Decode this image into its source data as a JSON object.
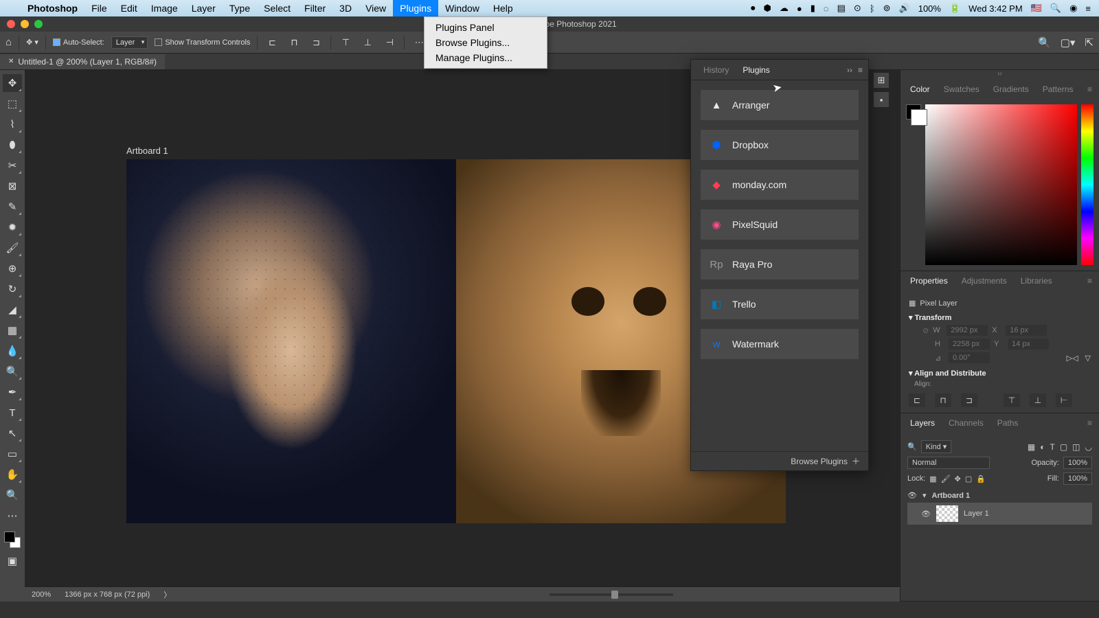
{
  "menubar": {
    "app": "Photoshop",
    "items": [
      "File",
      "Edit",
      "Image",
      "Layer",
      "Type",
      "Select",
      "Filter",
      "3D",
      "View",
      "Plugins",
      "Window",
      "Help"
    ],
    "active_index": 9,
    "tray": {
      "battery": "100%",
      "time": "Wed 3:42 PM"
    }
  },
  "dropdown": {
    "items": [
      "Plugins Panel",
      "Browse Plugins...",
      "Manage Plugins..."
    ]
  },
  "titlebar": {
    "title": "Adobe Photoshop 2021"
  },
  "optionsbar": {
    "auto_select_label": "Auto-Select:",
    "auto_select_target": "Layer",
    "show_transform_label": "Show Transform Controls"
  },
  "doc_tab": {
    "label": "Untitled-1 @ 200% (Layer 1, RGB/8#)"
  },
  "artboard": {
    "label": "Artboard 1"
  },
  "statusbar": {
    "zoom": "200%",
    "dims": "1366 px x 768 px (72 ppi)"
  },
  "plugins_panel": {
    "tabs": [
      "History",
      "Plugins"
    ],
    "active_tab": 1,
    "items": [
      {
        "icon": "▲",
        "color": "#e8e8e8",
        "name": "Arranger"
      },
      {
        "icon": "⬢",
        "color": "#0061ff",
        "name": "Dropbox"
      },
      {
        "icon": "◆",
        "color": "#ff3d57",
        "name": "monday.com"
      },
      {
        "icon": "◉",
        "color": "#ff4a8d",
        "name": "PixelSquid"
      },
      {
        "icon": "Rp",
        "color": "#999",
        "name": "Raya Pro"
      },
      {
        "icon": "◧",
        "color": "#0079bf",
        "name": "Trello"
      },
      {
        "icon": "w",
        "color": "#1473e6",
        "name": "Watermark"
      }
    ],
    "footer": "Browse Plugins"
  },
  "right": {
    "color_tabs": [
      "Color",
      "Swatches",
      "Gradients",
      "Patterns"
    ],
    "prop_tabs": [
      "Properties",
      "Adjustments",
      "Libraries"
    ],
    "layer_tabs": [
      "Layers",
      "Channels",
      "Paths"
    ],
    "properties": {
      "kind": "Pixel Layer",
      "transform_label": "Transform",
      "w": "2992 px",
      "h": "2258 px",
      "x": "16 px",
      "y": "14 px",
      "angle": "0.00°",
      "align_label": "Align and Distribute",
      "align_sub": "Align:"
    },
    "layers": {
      "kind": "Kind",
      "blend": "Normal",
      "opacity_label": "Opacity:",
      "opacity": "100%",
      "lock_label": "Lock:",
      "fill_label": "Fill:",
      "fill": "100%",
      "items": [
        {
          "name": "Artboard 1",
          "artboard": true
        },
        {
          "name": "Layer 1",
          "artboard": false
        }
      ]
    }
  }
}
